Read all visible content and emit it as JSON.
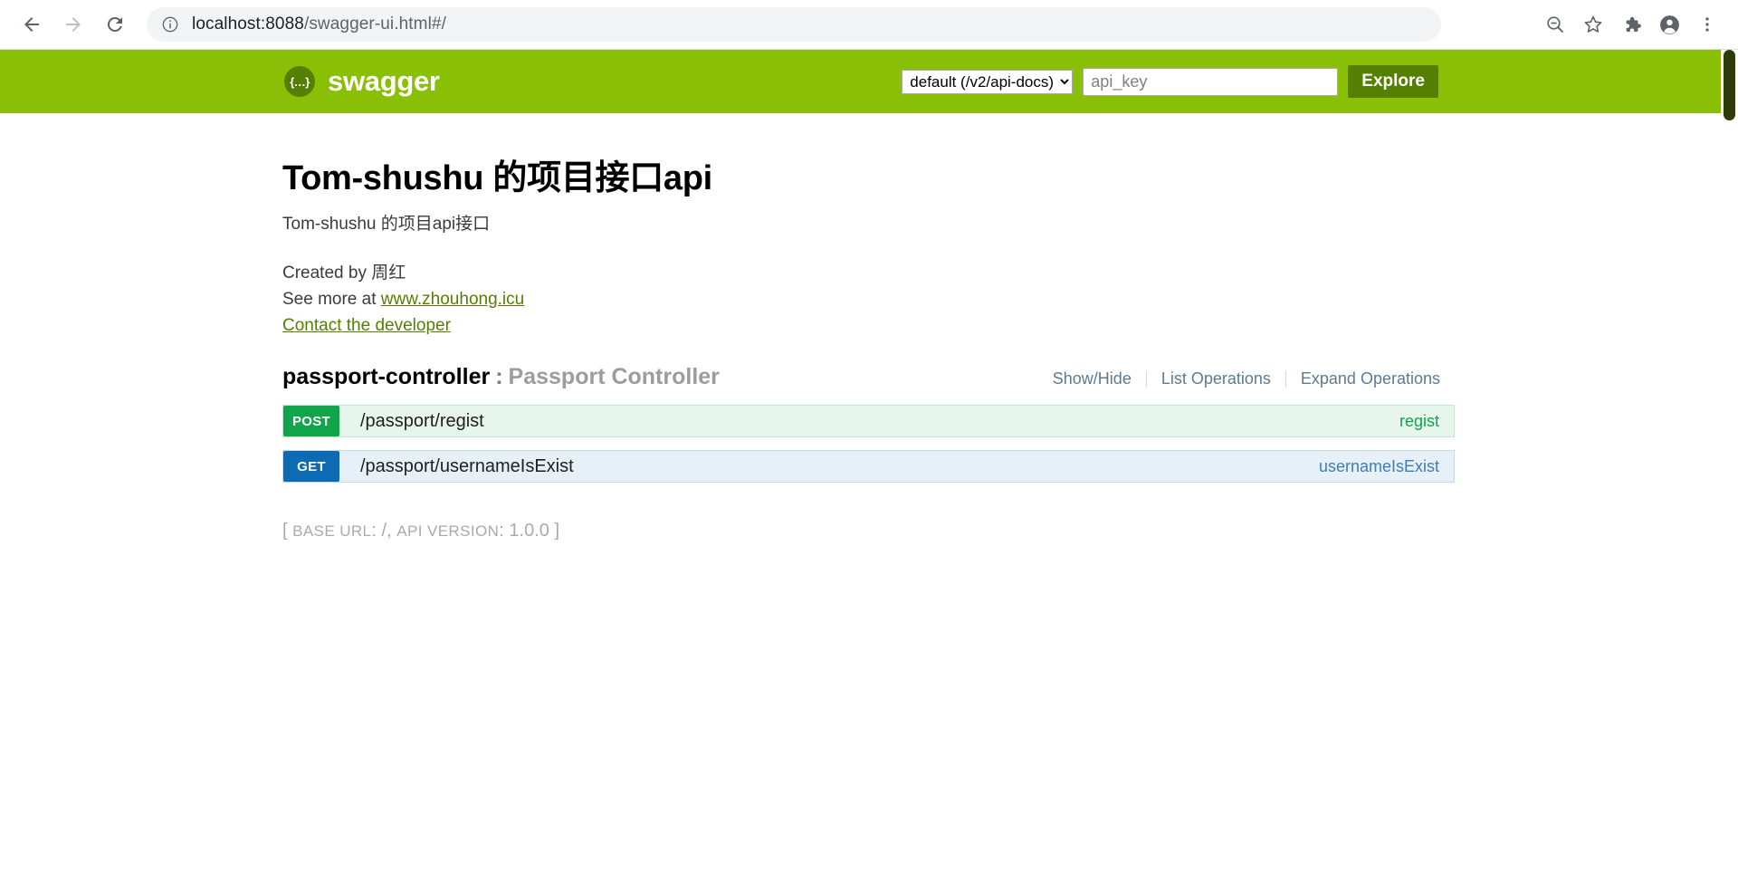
{
  "browser": {
    "nav": {
      "back_label": "Back",
      "forward_label": "Forward",
      "reload_label": "Reload"
    },
    "omnibox": {
      "info_icon": "site-info-icon",
      "url_host": "localhost:8088",
      "url_path": "/swagger-ui.html#/",
      "full_url": "localhost:8088/swagger-ui.html#/"
    },
    "toolbar": {
      "zoom_out_label": "Zoom out",
      "bookmark_label": "Bookmark this tab",
      "extensions_label": "Extensions",
      "profile_label": "Profile",
      "menu_label": "Customize and control Chrome"
    }
  },
  "swagger_header": {
    "logo_glyph": "{…}",
    "logo_text": "swagger",
    "spec_select": {
      "selected": "default (/v2/api-docs)",
      "options": [
        "default (/v2/api-docs)"
      ]
    },
    "api_key_placeholder": "api_key",
    "api_key_value": "",
    "explore_label": "Explore",
    "bg_color": "#89bf04",
    "accent_color": "#547f00"
  },
  "info": {
    "title": "Tom-shushu 的项目接口api",
    "description": "Tom-shushu 的项目api接口",
    "created_by_prefix": "Created by ",
    "created_by": "周红",
    "see_more_prefix": "See more at ",
    "see_more_link": "www.zhouhong.icu",
    "contact_link": "Contact the developer"
  },
  "resource": {
    "name": "passport-controller",
    "separator": ":",
    "description": "Passport Controller",
    "operations": {
      "show_hide": "Show/Hide",
      "list_operations": "List Operations",
      "expand_operations": "Expand Operations"
    }
  },
  "endpoints": [
    {
      "method": "POST",
      "path": "/passport/regist",
      "summary": "regist",
      "color": "#10a54a"
    },
    {
      "method": "GET",
      "path": "/passport/usernameIsExist",
      "summary": "usernameIsExist",
      "color": "#0f6ab4"
    }
  ],
  "footer": {
    "open_bracket": "[",
    "base_url_label": "BASE URL",
    "base_url_value": "/",
    "comma": ",",
    "api_version_label": "API VERSION",
    "api_version_value": "1.0.0",
    "close_bracket": "]"
  }
}
